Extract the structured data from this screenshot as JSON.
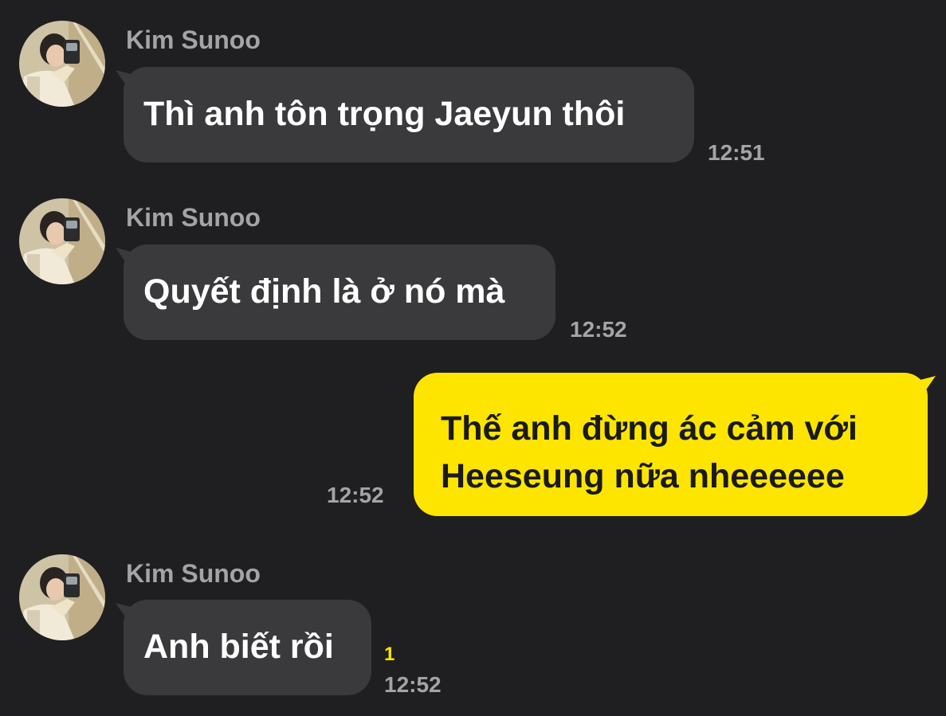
{
  "colors": {
    "background": "#1f1f21",
    "incoming_bubble": "#3a3a3d",
    "outgoing_bubble": "#fee500",
    "unread_count": "#fee500"
  },
  "messages": [
    {
      "direction": "incoming",
      "sender": "Kim Sunoo",
      "text": "Thì anh tôn trọng Jaeyun thôi",
      "time": "12:51"
    },
    {
      "direction": "incoming",
      "sender": "Kim Sunoo",
      "text": "Quyết định là ở nó mà",
      "time": "12:52"
    },
    {
      "direction": "outgoing",
      "line1": "Thế anh đừng ác cảm với",
      "line2": "Heeseung nữa nheeeeee",
      "time": "12:52"
    },
    {
      "direction": "incoming",
      "sender": "Kim Sunoo",
      "text": "Anh biết rồi",
      "time": "12:52",
      "unread": "1"
    }
  ]
}
